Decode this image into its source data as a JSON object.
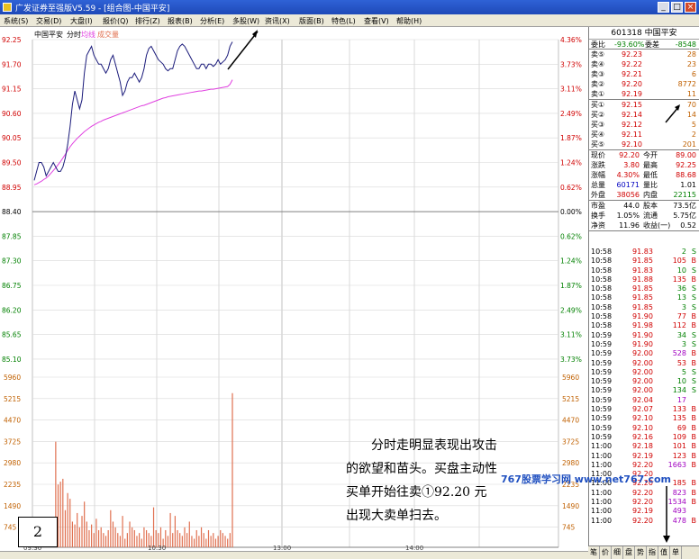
{
  "window": {
    "title": "广发证券至强版V5.59 - [组合图-中国平安]",
    "buttons": [
      "_",
      "□",
      "×"
    ]
  },
  "menu": [
    "系统(S)",
    "交易(D)",
    "大盘(I)",
    "报价(Q)",
    "排行(Z)",
    "报表(B)",
    "分析(E)",
    "多股(W)",
    "资讯(X)",
    "版面(B)",
    "特色(L)",
    "查看(V)",
    "帮助(H)"
  ],
  "chart_header": {
    "name": "中国平安",
    "mode": "分时",
    "avg_label": "均线",
    "vol_label": "成交量"
  },
  "colors": {
    "price_line": "#1a1a7a",
    "avg_line": "#e040e0",
    "volume": "#e07050",
    "up": "#d00000",
    "down": "#008000"
  },
  "chart_data": {
    "type": "line",
    "price_axis": [
      "92.25",
      "91.70",
      "91.15",
      "90.60",
      "90.05",
      "89.50",
      "88.95",
      "88.40",
      "87.85",
      "87.30",
      "86.75",
      "86.20",
      "85.65",
      "85.10"
    ],
    "pct_axis": [
      "4.36%",
      "3.73%",
      "3.11%",
      "2.49%",
      "1.87%",
      "1.24%",
      "0.62%",
      "0.00%",
      "0.62%",
      "1.24%",
      "1.87%",
      "2.49%",
      "3.11%",
      "3.73%"
    ],
    "volume_axis": [
      "5960",
      "5215",
      "4470",
      "3725",
      "2980",
      "2235",
      "1490",
      "745"
    ],
    "time_labels": [
      "09:30",
      "10:30",
      "13:00",
      "14:00"
    ],
    "ylim": [
      85.1,
      92.25
    ],
    "price": [
      89.1,
      89.3,
      89.5,
      89.5,
      89.4,
      89.2,
      89.3,
      89.4,
      89.5,
      89.4,
      89.3,
      89.3,
      89.4,
      89.6,
      89.9,
      90.3,
      90.8,
      91.1,
      90.9,
      90.7,
      90.9,
      91.5,
      91.9,
      92.0,
      92.1,
      91.9,
      91.8,
      91.7,
      91.7,
      91.6,
      91.5,
      91.6,
      91.8,
      91.9,
      91.7,
      91.5,
      91.3,
      91.0,
      91.1,
      91.3,
      91.4,
      91.4,
      91.5,
      91.4,
      91.3,
      91.4,
      91.6,
      91.9,
      92.05,
      92.1,
      92.0,
      91.9,
      91.8,
      91.75,
      91.7,
      91.6,
      91.55,
      91.6,
      91.6,
      91.8,
      92.0,
      92.1,
      92.15,
      92.1,
      92.0,
      91.9,
      91.8,
      91.7,
      91.6,
      91.6,
      91.7,
      91.7,
      91.6,
      91.7,
      91.7,
      91.65,
      91.7,
      91.8,
      91.7,
      91.75,
      91.8,
      91.9,
      92.1,
      92.2
    ],
    "avg": [
      89.0,
      89.02,
      89.05,
      89.08,
      89.12,
      89.15,
      89.2,
      89.26,
      89.32,
      89.38,
      89.45,
      89.52,
      89.6,
      89.68,
      89.77,
      89.85,
      89.92,
      89.98,
      90.04,
      90.09,
      90.14,
      90.19,
      90.23,
      90.27,
      90.31,
      90.34,
      90.37,
      90.4,
      90.42,
      90.45,
      90.47,
      90.49,
      90.51,
      90.53,
      90.55,
      90.57,
      90.59,
      90.61,
      90.63,
      90.65,
      90.67,
      90.69,
      90.71,
      90.73,
      90.75,
      90.77,
      90.78,
      90.8,
      90.82,
      90.84,
      90.86,
      90.88,
      90.9,
      90.92,
      90.94,
      90.95,
      90.97,
      90.98,
      90.99,
      91.0,
      91.01,
      91.02,
      91.03,
      91.04,
      91.05,
      91.06,
      91.07,
      91.08,
      91.09,
      91.1,
      91.1,
      91.11,
      91.12,
      91.13,
      91.14,
      91.14,
      91.15,
      91.16,
      91.17,
      91.18,
      91.19,
      91.2,
      91.25,
      91.35
    ],
    "volume": [
      700,
      900,
      500,
      400,
      600,
      300,
      300,
      500,
      600,
      3700,
      2200,
      2300,
      2400,
      1300,
      1900,
      1700,
      900,
      800,
      1200,
      700,
      1100,
      1600,
      900,
      600,
      800,
      500,
      1000,
      600,
      700,
      500,
      400,
      600,
      1300,
      900,
      700,
      500,
      400,
      1100,
      300,
      500,
      900,
      700,
      600,
      400,
      500,
      300,
      700,
      600,
      500,
      400,
      1400,
      600,
      500,
      700,
      300,
      600,
      400,
      1200,
      500,
      1100,
      600,
      500,
      400,
      700,
      500,
      900,
      400,
      300,
      600,
      400,
      700,
      500,
      300,
      600,
      400,
      500,
      300,
      400,
      600,
      500,
      400,
      300,
      500,
      5400
    ]
  },
  "quote": {
    "code_name": "601318 中国平安",
    "weibi_label": "委比",
    "weibi": "-93.60%",
    "weicha_label": "委差",
    "weicha": "-8548",
    "asks": [
      {
        "label": "卖⑤",
        "price": "92.23",
        "vol": "28"
      },
      {
        "label": "卖④",
        "price": "92.22",
        "vol": "23"
      },
      {
        "label": "卖③",
        "price": "92.21",
        "vol": "6"
      },
      {
        "label": "卖②",
        "price": "92.20",
        "vol": "8772"
      },
      {
        "label": "卖①",
        "price": "92.19",
        "vol": "11"
      }
    ],
    "bids": [
      {
        "label": "买①",
        "price": "92.15",
        "vol": "70"
      },
      {
        "label": "买②",
        "price": "92.14",
        "vol": "14"
      },
      {
        "label": "买③",
        "price": "92.12",
        "vol": "5"
      },
      {
        "label": "买④",
        "price": "92.11",
        "vol": "2"
      },
      {
        "label": "买⑤",
        "price": "92.10",
        "vol": "201"
      }
    ],
    "stats": [
      {
        "l1": "现价",
        "v1": "92.20",
        "l2": "今开",
        "v2": "89.00"
      },
      {
        "l1": "涨跌",
        "v1": "3.80",
        "l2": "最高",
        "v2": "92.25"
      },
      {
        "l1": "涨幅",
        "v1": "4.30%",
        "l2": "最低",
        "v2": "88.68"
      },
      {
        "l1": "总量",
        "v1": "60171",
        "l2": "量比",
        "v2": "1.01"
      },
      {
        "l1": "外盘",
        "v1": "38056",
        "l2": "内盘",
        "v2": "22115"
      }
    ],
    "stats2": [
      {
        "l1": "市盈",
        "v1": "44.0",
        "l2": "股本",
        "v2": "73.5亿"
      },
      {
        "l1": "换手",
        "v1": "1.05%",
        "l2": "流通",
        "v2": "5.75亿"
      },
      {
        "l1": "净资",
        "v1": "11.96",
        "l2": "收益(一)",
        "v2": "0.52"
      }
    ]
  },
  "ticks": [
    {
      "t": "10:58",
      "p": "91.83",
      "v": "2",
      "s": "S"
    },
    {
      "t": "10:58",
      "p": "91.85",
      "v": "105",
      "s": "B"
    },
    {
      "t": "10:58",
      "p": "91.83",
      "v": "10",
      "s": "S"
    },
    {
      "t": "10:58",
      "p": "91.88",
      "v": "135",
      "s": "B"
    },
    {
      "t": "10:58",
      "p": "91.85",
      "v": "36",
      "s": "S"
    },
    {
      "t": "10:58",
      "p": "91.85",
      "v": "13",
      "s": "S"
    },
    {
      "t": "10:58",
      "p": "91.85",
      "v": "3",
      "s": "S"
    },
    {
      "t": "10:58",
      "p": "91.90",
      "v": "77",
      "s": "B"
    },
    {
      "t": "10:58",
      "p": "91.98",
      "v": "112",
      "s": "B"
    },
    {
      "t": "10:59",
      "p": "91.90",
      "v": "34",
      "s": "S"
    },
    {
      "t": "10:59",
      "p": "91.90",
      "v": "3",
      "s": "S"
    },
    {
      "t": "10:59",
      "p": "92.00",
      "v": "528",
      "s": "B"
    },
    {
      "t": "10:59",
      "p": "92.00",
      "v": "53",
      "s": "B"
    },
    {
      "t": "10:59",
      "p": "92.00",
      "v": "5",
      "s": "S"
    },
    {
      "t": "10:59",
      "p": "92.00",
      "v": "10",
      "s": "S"
    },
    {
      "t": "10:59",
      "p": "92.00",
      "v": "134",
      "s": "S"
    },
    {
      "t": "10:59",
      "p": "92.04",
      "v": "17",
      "s": ""
    },
    {
      "t": "10:59",
      "p": "92.07",
      "v": "133",
      "s": "B"
    },
    {
      "t": "10:59",
      "p": "92.10",
      "v": "135",
      "s": "B"
    },
    {
      "t": "10:59",
      "p": "92.10",
      "v": "69",
      "s": "B"
    },
    {
      "t": "10:59",
      "p": "92.16",
      "v": "109",
      "s": "B"
    },
    {
      "t": "11:00",
      "p": "92.18",
      "v": "101",
      "s": "B"
    },
    {
      "t": "11:00",
      "p": "92.19",
      "v": "123",
      "s": "B"
    },
    {
      "t": "11:00",
      "p": "92.20",
      "v": "1663",
      "s": "B"
    },
    {
      "t": "11:00",
      "p": "92.20",
      "v": "",
      "s": ""
    },
    {
      "t": "11:00",
      "p": "92.20",
      "v": "185",
      "s": "B"
    },
    {
      "t": "11:00",
      "p": "92.20",
      "v": "823",
      "s": "B"
    },
    {
      "t": "11:00",
      "p": "92.20",
      "v": "1534",
      "s": "B"
    },
    {
      "t": "11:00",
      "p": "92.19",
      "v": "493",
      "s": ""
    },
    {
      "t": "11:00",
      "p": "92.20",
      "v": "478",
      "s": "B"
    }
  ],
  "bottom_tabs": [
    "笔",
    "价",
    "细",
    "盘",
    "势",
    "指",
    "值",
    "单"
  ],
  "annotation": {
    "lines": [
      "分时走明显表现出攻击",
      "的欲望和苗头。买盘主动性",
      "买单开始往卖①92.20 元",
      "出现大卖单扫去。"
    ],
    "panel_number": "2",
    "watermark": "767股票学习网 www.net767.com"
  }
}
